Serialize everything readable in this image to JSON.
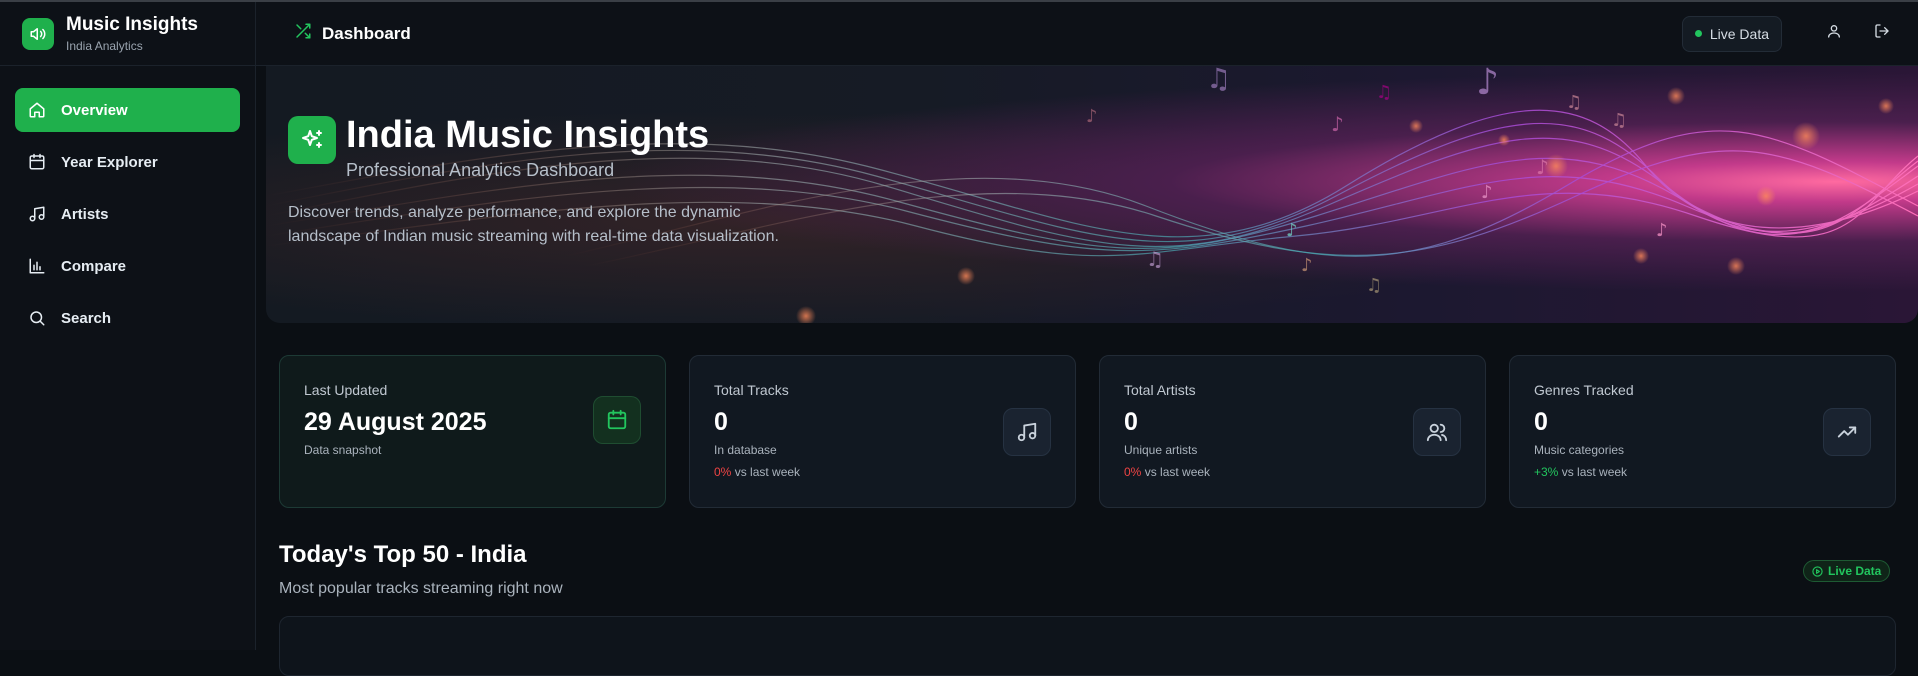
{
  "brand": {
    "title": "Music Insights",
    "subtitle": "India Analytics",
    "logo_icon": "speaker-icon"
  },
  "nav": {
    "items": [
      {
        "label": "Overview",
        "icon": "home-icon",
        "active": true
      },
      {
        "label": "Year Explorer",
        "icon": "calendar-icon",
        "active": false
      },
      {
        "label": "Artists",
        "icon": "music-note-icon",
        "active": false
      },
      {
        "label": "Compare",
        "icon": "bar-chart-icon",
        "active": false
      },
      {
        "label": "Search",
        "icon": "search-icon",
        "active": false
      }
    ]
  },
  "topbar": {
    "title": "Dashboard",
    "title_icon": "shuffle-icon",
    "live_label": "Live Data"
  },
  "hero": {
    "title": "India Music Insights",
    "subtitle": "Professional Analytics Dashboard",
    "description": "Discover trends, analyze performance, and explore the dynamic landscape of Indian music streaming with real-time data visualization.",
    "icon": "sparkles-icon"
  },
  "stats": [
    {
      "label": "Last Updated",
      "value": "29 August 2025",
      "note": "Data snapshot",
      "delta": "",
      "delta_text": "",
      "icon": "calendar-icon"
    },
    {
      "label": "Total Tracks",
      "value": "0",
      "note": "In database",
      "delta": "0%",
      "delta_text": "vs last week",
      "icon": "music-note-icon"
    },
    {
      "label": "Total Artists",
      "value": "0",
      "note": "Unique artists",
      "delta": "0%",
      "delta_text": "vs last week",
      "icon": "users-icon"
    },
    {
      "label": "Genres Tracked",
      "value": "0",
      "note": "Music categories",
      "delta": "+3%",
      "delta_text": "vs last week",
      "icon": "trending-up-icon"
    }
  ],
  "top50": {
    "title": "Today's Top 50 - India",
    "subtitle": "Most popular tracks streaming right now",
    "badge": "Live Data"
  },
  "colors": {
    "accent": "#1fb04c",
    "background": "#0b0f14",
    "negative": "#ef4444",
    "positive": "#22c55e"
  }
}
